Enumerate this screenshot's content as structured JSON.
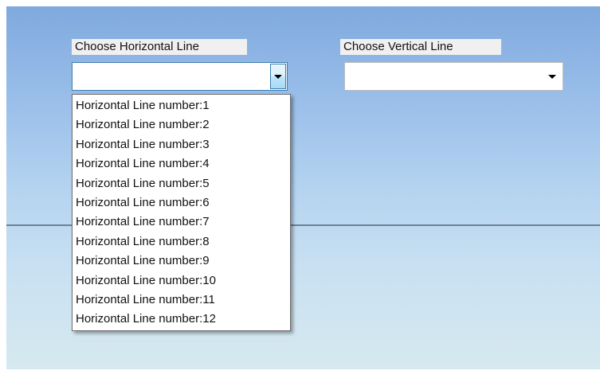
{
  "horizontal": {
    "label": "Choose Horizontal Line",
    "value": "",
    "options": [
      "Horizontal Line number:1",
      "Horizontal Line number:2",
      "Horizontal Line number:3",
      "Horizontal Line number:4",
      "Horizontal Line number:5",
      "Horizontal Line number:6",
      "Horizontal Line number:7",
      "Horizontal Line number:8",
      "Horizontal Line number:9",
      "Horizontal Line number:10",
      "Horizontal Line number:11",
      "Horizontal Line number:12"
    ]
  },
  "vertical": {
    "label": "Choose Vertical Line",
    "value": ""
  },
  "icons": {
    "dropdown_arrow": "chevron-down-icon"
  },
  "colors": {
    "combo_focus_border": "#3c7fb1",
    "background_top": "#7fa9de",
    "background_bottom": "#d6e9f0",
    "drawn_line": "#6f7f93"
  }
}
